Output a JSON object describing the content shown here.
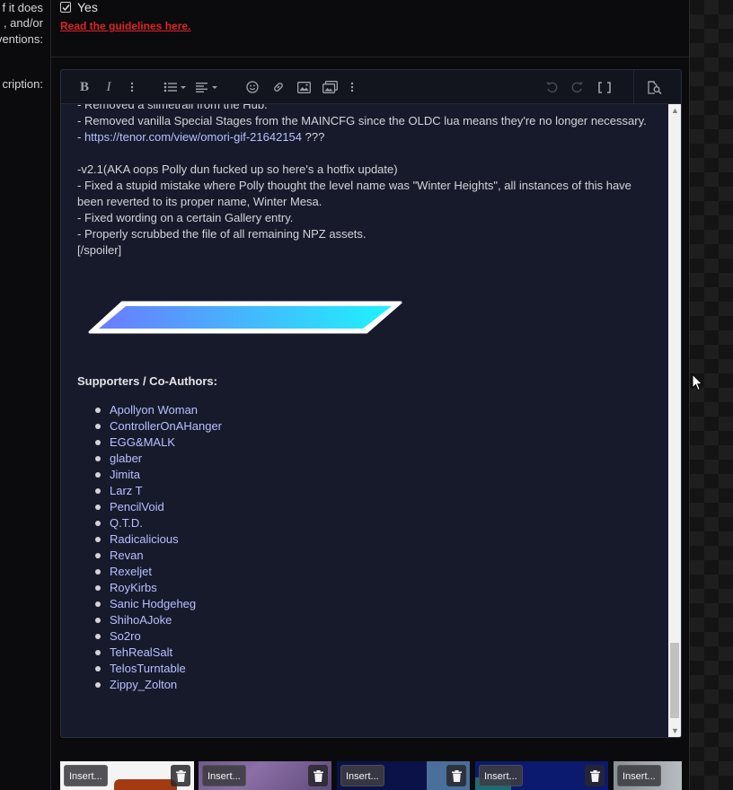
{
  "form_labels": {
    "label_1": "f it does",
    "label_2": ", and/or",
    "label_3": "ventions:",
    "label_4": "cription:"
  },
  "checkbox": {
    "label": "Yes",
    "checked": true
  },
  "guidelines_link": "Read the guidelines here.",
  "toolbar": {
    "bold": "B",
    "italic": "I",
    "icons": [
      "bold-icon",
      "italic-icon",
      "more-text-icon",
      "list-icon",
      "align-icon",
      "emoji-icon",
      "link-icon",
      "image-icon",
      "media-icon",
      "more-insert-icon",
      "undo-icon",
      "redo-icon",
      "bbcode-toggle-icon",
      "preview-icon"
    ]
  },
  "content": {
    "lines": [
      "- Removed a slimetrail from the Hub.",
      "- Removed vanilla Special Stages from the MAINCFG since the OLDC lua means they're no longer necessary.",
      "- ",
      "https://tenor.com/view/omori-gif-21642154",
      " ???",
      "-v2.1(AKA oops Polly dun fucked up so here's a hotfix update)",
      "- Fixed a stupid mistake where Polly thought the level name was \"Winter Heights\", all instances of this have been reverted to its proper name, Winter Mesa.",
      "- Fixed wording on a certain Gallery entry.",
      "- Properly scrubbed the file of all remaining NPZ assets.",
      "[/spoiler]"
    ],
    "supporters_heading": "Supporters / Co-Authors:",
    "supporters": [
      "Apollyon Woman",
      "ControllerOnAHanger",
      "EGG&MALK",
      "glaber",
      "Jimita",
      "Larz T",
      "PencilVoid",
      "Q.T.D.",
      "Radicalicious",
      "Revan",
      "Rexeljet",
      "RoyKirbs",
      "Sanic Hodgeheg",
      "ShihoAJoke",
      "So2ro",
      "TehRealSalt",
      "TelosTurntable",
      "Zippy_Zolton"
    ]
  },
  "attachments": {
    "insert_label": "Insert...",
    "items": [
      "attachment-1",
      "attachment-2",
      "attachment-3",
      "attachment-4",
      "attachment-5"
    ]
  },
  "colors": {
    "accent_link": "#b6c0ff",
    "warning_link": "#e02424",
    "banner_gradient_start": "#6b7bff",
    "banner_gradient_end": "#1ff2ff"
  }
}
